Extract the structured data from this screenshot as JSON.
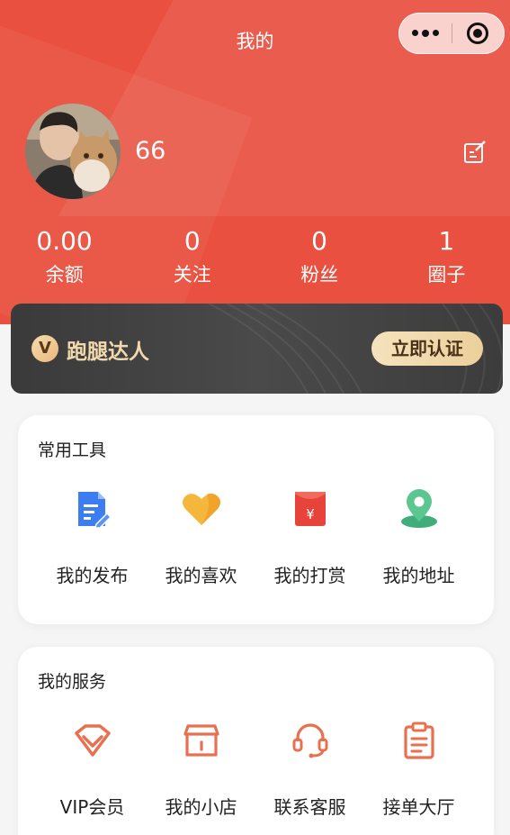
{
  "nav": {
    "title": "我的"
  },
  "profile": {
    "username": "66"
  },
  "stats": [
    {
      "value": "0.00",
      "label": "余额"
    },
    {
      "value": "0",
      "label": "关注"
    },
    {
      "value": "0",
      "label": "粉丝"
    },
    {
      "value": "1",
      "label": "圈子"
    }
  ],
  "vip": {
    "badge": "V",
    "title": "跑腿达人",
    "button": "立即认证"
  },
  "tools": {
    "title": "常用工具",
    "items": [
      {
        "label": "我的发布",
        "icon": "document-edit-icon"
      },
      {
        "label": "我的喜欢",
        "icon": "heart-icon"
      },
      {
        "label": "我的打赏",
        "icon": "red-envelope-icon"
      },
      {
        "label": "我的地址",
        "icon": "location-pin-icon"
      }
    ]
  },
  "services": {
    "title": "我的服务",
    "items": [
      {
        "label": "VIP会员",
        "icon": "diamond-icon"
      },
      {
        "label": "我的小店",
        "icon": "shop-icon"
      },
      {
        "label": "联系客服",
        "icon": "headset-icon"
      },
      {
        "label": "接单大厅",
        "icon": "clipboard-icon"
      }
    ]
  },
  "colors": {
    "primary": "#e9503f",
    "icon_orange": "#e8704f",
    "vip_gold": "#f2d9ad"
  }
}
